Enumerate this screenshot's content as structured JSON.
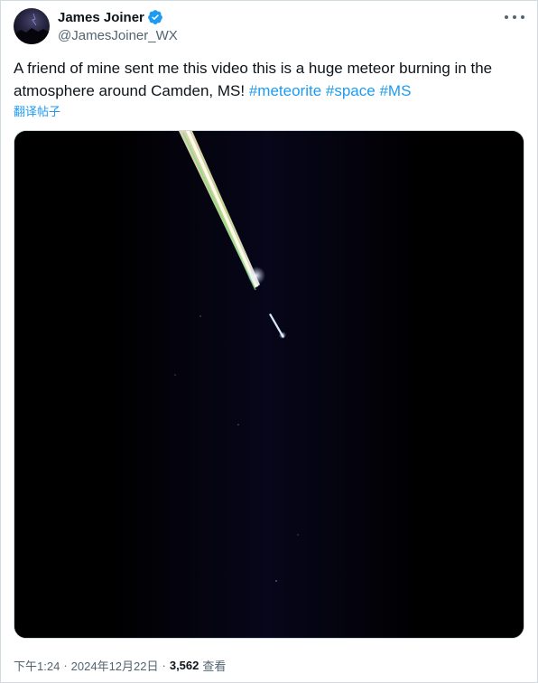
{
  "author": {
    "display_name": "James Joiner",
    "handle": "@JamesJoiner_WX",
    "verified": true,
    "verified_color": "#1d9bf0"
  },
  "menu": {
    "icon": "more-horizontal-icon"
  },
  "tweet": {
    "text_before_tags": "A friend of mine sent me this video this is a huge meteor burning in the atmosphere around Camden, MS!",
    "hashtags": [
      "#meteorite",
      "#space",
      "#MS"
    ],
    "translate_label": "翻译帖子"
  },
  "media": {
    "type": "video",
    "description_icon": "video-thumbnail"
  },
  "meta": {
    "time": "下午1:24",
    "separator": "·",
    "date": "2024年12月22日",
    "views_count": "3,562",
    "views_label": "查看"
  },
  "colors": {
    "link": "#1d9bf0",
    "secondary_text": "#536471",
    "primary_text": "#0f1419",
    "border": "#cfd9de"
  }
}
